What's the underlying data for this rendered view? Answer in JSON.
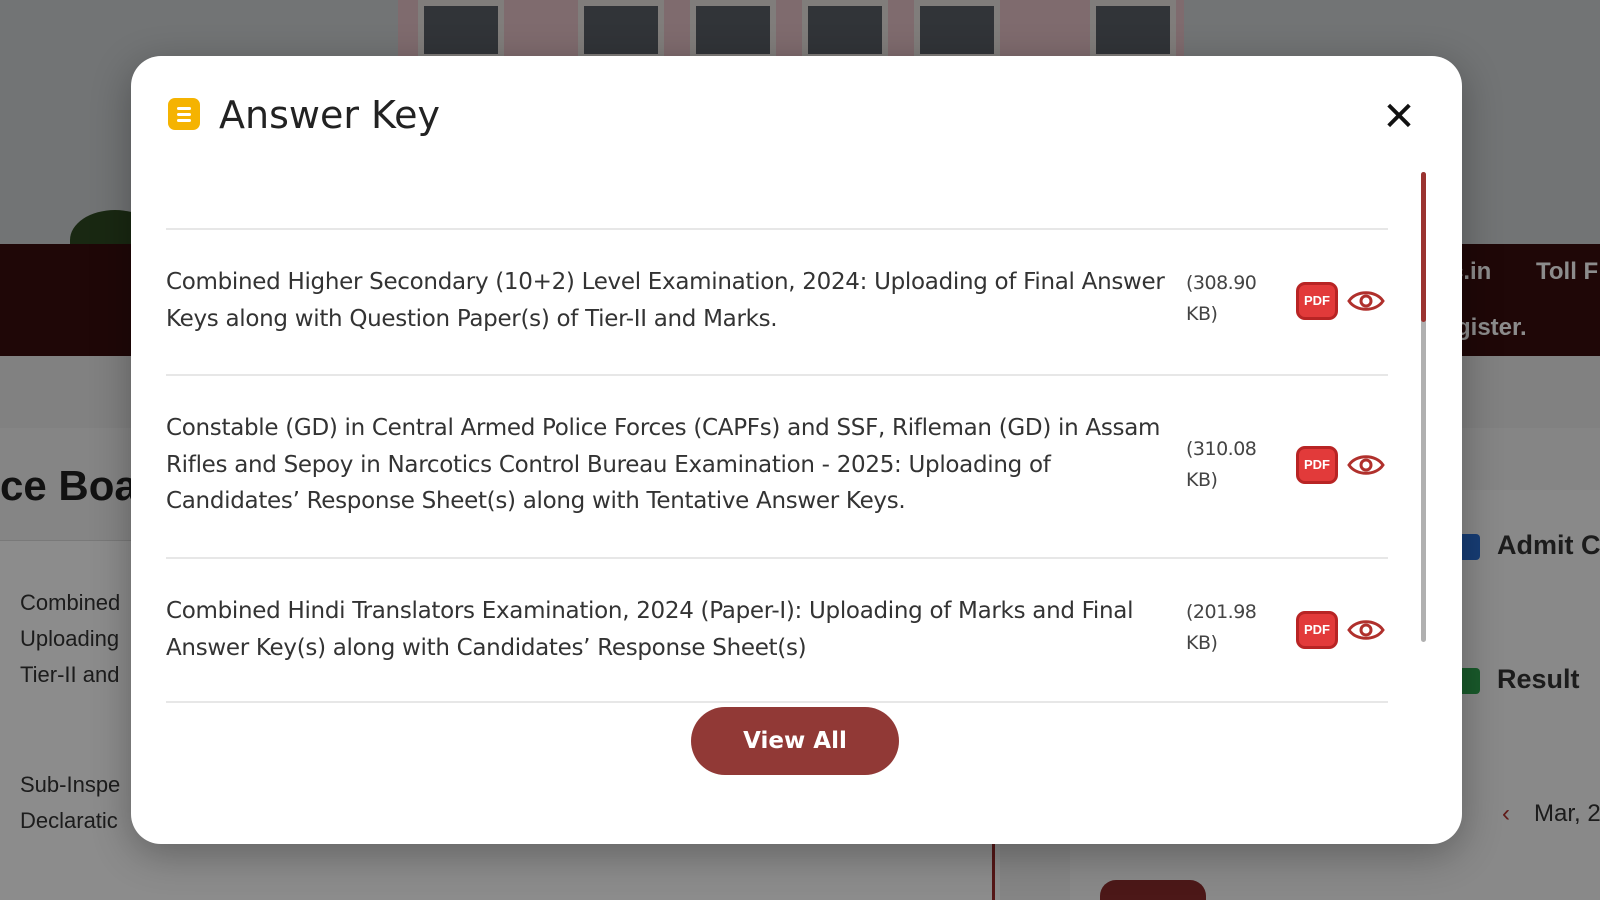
{
  "background": {
    "navbar": {
      "text_1": "c.in",
      "text_2": "Toll F",
      "text_3": "gister."
    },
    "section_title": "ce Boa",
    "left_items": [
      {
        "lines": [
          "Combined",
          "Uploading",
          "Tier-II and"
        ]
      },
      {
        "lines": [
          "Sub-Inspe",
          "Declaratic"
        ]
      }
    ],
    "right_items": [
      {
        "label": "Admit C",
        "icon": "admit-card-icon",
        "color": "#2b6fd6"
      },
      {
        "label": "Result",
        "icon": "result-icon",
        "color": "#2ea44f"
      }
    ],
    "date_text": "Mar, 2"
  },
  "modal": {
    "title": "Answer Key",
    "header_icon": "document-list-icon",
    "close_glyph": "✕",
    "items": [
      {
        "title": "Combined Higher Secondary (10+2) Level Examination, 2024: Uploading of Final Answer Keys along with Question Paper(s) of Tier-II and Marks.",
        "size_line1": "(308.90",
        "size_line2": "KB)",
        "pdf_label": "PDF"
      },
      {
        "title": "Constable (GD) in Central Armed Police Forces (CAPFs) and SSF, Rifleman (GD) in Assam Rifles and Sepoy in Narcotics Control Bureau Examination - 2025: Uploading of Candidates’ Response Sheet(s) along with Tentative Answer Keys.",
        "size_line1": "(310.08",
        "size_line2": "KB)",
        "pdf_label": "PDF"
      },
      {
        "title": "Combined Hindi Translators Examination, 2024 (Paper-I): Uploading of Marks and Final Answer Key(s) along with Candidates’ Response Sheet(s)",
        "size_line1": "(201.98",
        "size_line2": "KB)",
        "pdf_label": "PDF"
      }
    ],
    "view_all_label": "View All",
    "colors": {
      "accent": "#913936",
      "pdf_red": "#e23a3a",
      "header_icon": "#f5b301"
    }
  }
}
